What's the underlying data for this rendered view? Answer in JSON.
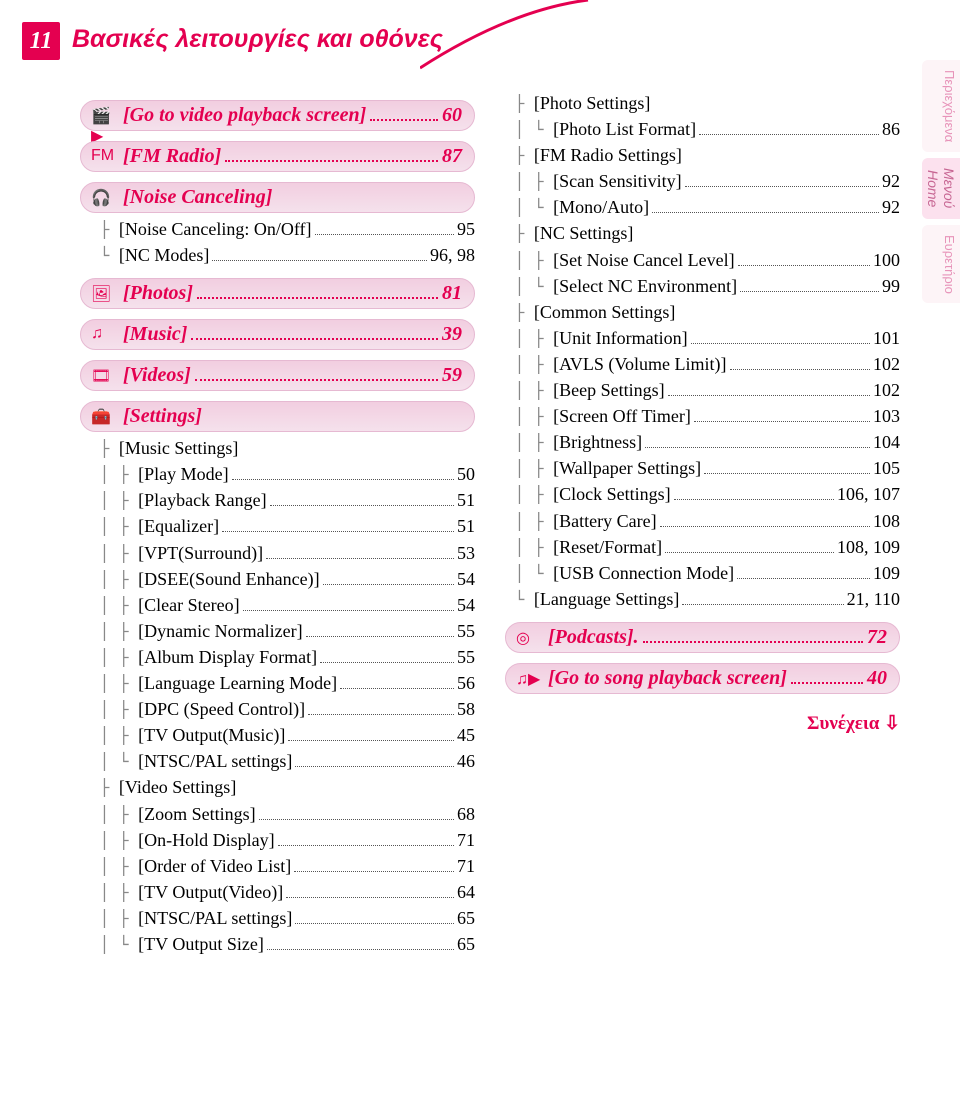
{
  "page_number": "11",
  "page_title": "Βασικές λειτουργίες και οθόνες",
  "left": {
    "videoPlayback": {
      "icon": "🎬▶",
      "label": "[Go to video playback screen]",
      "page": "60"
    },
    "fmRadio": {
      "icon": "FM",
      "label": "[FM Radio]",
      "page": "87"
    },
    "noiseCanceling": {
      "icon": "🎧",
      "label": "[Noise Canceling]",
      "items": [
        {
          "label": "[Noise Canceling: On/Off]",
          "page": "95"
        },
        {
          "label": "[NC Modes]",
          "page": "96, 98"
        }
      ]
    },
    "photos": {
      "icon": "🖼",
      "label": "[Photos]",
      "page": "81"
    },
    "music": {
      "icon": "♫",
      "label": "[Music]",
      "page": "39"
    },
    "videos": {
      "icon": "🎞",
      "label": "[Videos]",
      "page": "59"
    },
    "settings": {
      "icon": "🧰",
      "label": "[Settings]",
      "musicSettings": {
        "label": "[Music Settings]",
        "items": [
          {
            "label": "[Play Mode]",
            "page": "50"
          },
          {
            "label": "[Playback Range]",
            "page": "51"
          },
          {
            "label": "[Equalizer]",
            "page": "51"
          },
          {
            "label": "[VPT(Surround)]",
            "page": "53"
          },
          {
            "label": "[DSEE(Sound Enhance)]",
            "page": "54"
          },
          {
            "label": "[Clear Stereo]",
            "page": "54"
          },
          {
            "label": "[Dynamic Normalizer]",
            "page": "55"
          },
          {
            "label": "[Album Display Format]",
            "page": "55"
          },
          {
            "label": "[Language Learning Mode]",
            "page": "56"
          },
          {
            "label": "[DPC (Speed Control)]",
            "page": "58"
          },
          {
            "label": "[TV Output(Music)]",
            "page": "45"
          },
          {
            "label": "[NTSC/PAL settings]",
            "page": "46"
          }
        ]
      },
      "videoSettings": {
        "label": "[Video Settings]",
        "items": [
          {
            "label": "[Zoom Settings]",
            "page": "68"
          },
          {
            "label": "[On-Hold Display]",
            "page": "71"
          },
          {
            "label": "[Order of Video List]",
            "page": "71"
          },
          {
            "label": "[TV Output(Video)]",
            "page": "64"
          },
          {
            "label": "[NTSC/PAL settings]",
            "page": "65"
          },
          {
            "label": "[TV Output Size]",
            "page": "65"
          }
        ]
      }
    }
  },
  "right": {
    "photoSettings": {
      "label": "[Photo Settings]",
      "items": [
        {
          "label": "[Photo List Format]",
          "page": "86"
        }
      ]
    },
    "fmRadioSettings": {
      "label": "[FM Radio Settings]",
      "items": [
        {
          "label": "[Scan Sensitivity]",
          "page": "92"
        },
        {
          "label": "[Mono/Auto]",
          "page": "92"
        }
      ]
    },
    "ncSettings": {
      "label": "[NC Settings]",
      "items": [
        {
          "label": "[Set Noise Cancel Level]",
          "page": "100"
        },
        {
          "label": "[Select NC Environment]",
          "page": "99"
        }
      ]
    },
    "commonSettings": {
      "label": "[Common Settings]",
      "items": [
        {
          "label": "[Unit Information]",
          "page": "101"
        },
        {
          "label": "[AVLS (Volume Limit)]",
          "page": "102"
        },
        {
          "label": "[Beep Settings]",
          "page": "102"
        },
        {
          "label": "[Screen Off Timer]",
          "page": "103"
        },
        {
          "label": "[Brightness]",
          "page": "104"
        },
        {
          "label": "[Wallpaper Settings]",
          "page": "105"
        },
        {
          "label": "[Clock Settings]",
          "page": "106, 107"
        },
        {
          "label": "[Battery Care]",
          "page": "108"
        },
        {
          "label": "[Reset/Format]",
          "page": "108, 109"
        },
        {
          "label": "[USB Connection Mode]",
          "page": "109"
        }
      ]
    },
    "language": {
      "label": "[Language Settings]",
      "page": "21, 110"
    },
    "podcasts": {
      "icon": "◎",
      "label": "[Podcasts].",
      "page": "72"
    },
    "songPlayback": {
      "icon": "♫▶",
      "label": "[Go to song playback screen]",
      "page": "40"
    },
    "continued": "Συνέχεια ⇩"
  },
  "tabs": {
    "t1a": "Περιεχόμενα",
    "t2a": "Μενού",
    "t2b": "Home",
    "t3a": "Ευρετήριο"
  }
}
